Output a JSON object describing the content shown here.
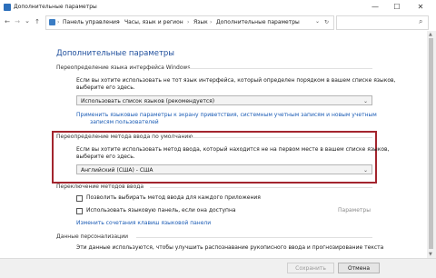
{
  "window": {
    "title": "Дополнительные параметры",
    "minimize_glyph": "—",
    "maximize_glyph": "☐",
    "close_glyph": "✕"
  },
  "nav": {
    "back": "←",
    "forward": "→",
    "up": "↑",
    "refresh": "↻",
    "dropdown": "⌄",
    "breadcrumb": [
      "Панель управления",
      "Часы, язык и регион",
      "Язык",
      "Дополнительные параметры"
    ],
    "separator": "›",
    "search_placeholder": "",
    "search_icon": "⌕"
  },
  "page": {
    "title": "Дополнительные параметры",
    "ui_language": {
      "heading": "Переопределение языка интерфейса Windows",
      "description_line1": "Если вы хотите использовать не тот язык интерфейса, который определен порядком в вашем списке языков,",
      "description_line2": "выберите его здесь.",
      "selected": "Использовать список языков (рекомендуется)",
      "link_line1": "Применить языковые параметры к экрану приветствия, системным учетным записям и новым учетным",
      "link_line2": "записям пользователей"
    },
    "input_method": {
      "heading": "Переопределение метода ввода по умолчанию",
      "description_line1": "Если вы хотите использовать метод ввода, который находится не на первом месте в вашем списке языков,",
      "description_line2": "выберите его здесь.",
      "selected": "Английский (США) - США"
    },
    "switching": {
      "heading": "Переключение методов ввода",
      "checkbox1": "Позволить выбирать метод ввода для каждого приложения",
      "checkbox2": "Использовать языковую панель, если она доступна",
      "options_link": "Параметры",
      "hotkeys_link": "Изменить сочетания клавиш языковой панели"
    },
    "personalization": {
      "heading": "Данные персонализации",
      "description_line1": "Эти данные используются, чтобы улучшить распознавание рукописного ввода и прогнозирование текста"
    }
  },
  "footer": {
    "save": "Сохранить",
    "cancel": "Отмена"
  },
  "colors": {
    "heading_blue": "#1e4e9c",
    "link_blue": "#1a5bb5",
    "highlight_red": "#a3252e"
  }
}
